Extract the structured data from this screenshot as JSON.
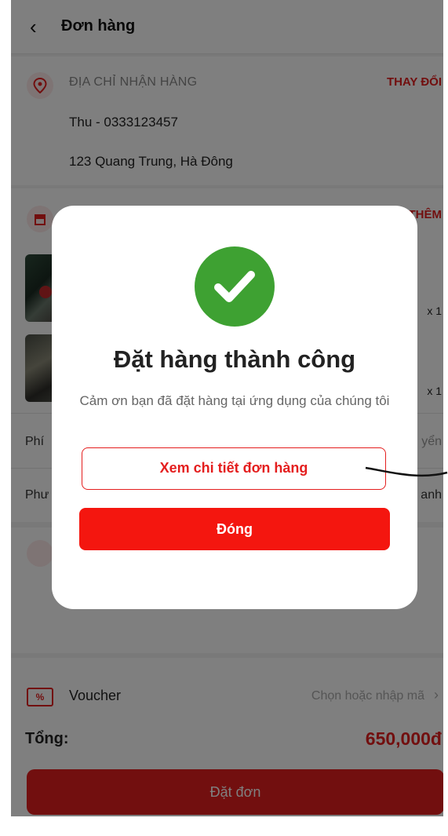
{
  "header": {
    "back_icon": "chevron-left-icon",
    "title": "Đơn hàng"
  },
  "address": {
    "label": "ĐỊA CHỈ NHẬN HÀNG",
    "change_label": "THAY ĐỔI",
    "name_phone": "Thu - 0333123457",
    "street": "123 Quang Trung, Hà Đông"
  },
  "products": {
    "add_more_label": "THÊM",
    "items": [
      {
        "qty": "x 1"
      },
      {
        "qty": "x 1"
      }
    ],
    "rows": [
      {
        "label": "Phí",
        "value": "yển"
      },
      {
        "label": "Phư",
        "value": "anh"
      }
    ]
  },
  "voucher": {
    "label": "Voucher",
    "hint": "Chọn hoặc nhập mã",
    "chevron": "›"
  },
  "total": {
    "label": "Tổng:",
    "value": "650,000đ"
  },
  "order_button": "Đặt đơn",
  "modal": {
    "icon": "check-circle-icon",
    "title": "Đặt hàng thành công",
    "message": "Cảm ơn bạn đã đặt hàng tại ứng dụng của chúng tôi",
    "detail_button": "Xem chi tiết đơn hàng",
    "close_button": "Đóng"
  },
  "colors": {
    "accent": "#e41e1e",
    "success": "#3ea132"
  }
}
